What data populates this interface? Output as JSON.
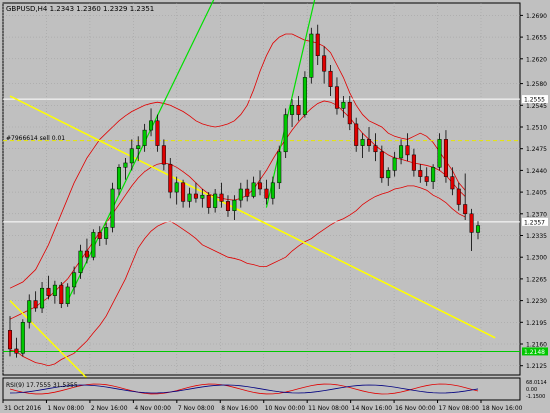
{
  "symbol_label": "GBPUSD,H4  1.2343 1.2360 1.2329 1.2351",
  "order_label": "#7966614 sell 0.01",
  "sub_label": "RSI(9) 17.7555 31.5355",
  "colors": {
    "background": "#c0c0c0",
    "grid": "#9e9e9e",
    "text": "#000000",
    "bull": "#00c800",
    "bear": "#e00000",
    "band": "#e00000",
    "trendline_green": "#00e000",
    "trendline_yellow": "#ffff00",
    "hline_white": "#ffffff",
    "hline_green": "#00c800",
    "order_line": "#e6e600"
  },
  "chart_data": {
    "type": "candlestick",
    "title": "GBPUSD,H4  1.2343 1.2360 1.2329 1.2351",
    "ylim": [
      1.211,
      1.271
    ],
    "y_ticks": [
      "1.2690",
      "1.2655",
      "1.2620",
      "1.2580",
      "1.2545",
      "1.2510",
      "1.2475",
      "1.2440",
      "1.2405",
      "1.2370",
      "1.2335",
      "1.2300",
      "1.2265",
      "1.2230",
      "1.2195",
      "1.2160",
      "1.2125"
    ],
    "x_ticks": [
      "31 Oct 2016",
      "1 Nov 08:00",
      "2 Nov 16:00",
      "4 Nov 00:00",
      "7 Nov 08:00",
      "8 Nov 16:00",
      "10 Nov 00:00",
      "11 Nov 08:00",
      "14 Nov 16:00",
      "16 Nov 00:00",
      "17 Nov 08:00",
      "18 Nov 16:00"
    ],
    "price_tags": [
      {
        "value": "1.2555",
        "level": 1.2555,
        "color": "#ffffff"
      },
      {
        "value": "1.2357",
        "level": 1.2357,
        "color": "#ffffff"
      },
      {
        "value": "1.2148",
        "level": 1.2148,
        "color": "#00c800"
      }
    ],
    "order_level": 1.2488,
    "sub_ticks": [
      "68.0114",
      "0.00",
      "-1.1500"
    ],
    "candles": [
      [
        1.2182,
        1.2205,
        1.214,
        1.2152
      ],
      [
        1.2152,
        1.217,
        1.2138,
        1.2145
      ],
      [
        1.2145,
        1.22,
        1.214,
        1.2195
      ],
      [
        1.2195,
        1.224,
        1.2185,
        1.223
      ],
      [
        1.223,
        1.2245,
        1.2212,
        1.2218
      ],
      [
        1.2218,
        1.226,
        1.221,
        1.225
      ],
      [
        1.225,
        1.227,
        1.2232,
        1.2238
      ],
      [
        1.2238,
        1.2262,
        1.2225,
        1.2255
      ],
      [
        1.2255,
        1.226,
        1.2218,
        1.2225
      ],
      [
        1.2225,
        1.2258,
        1.222,
        1.2252
      ],
      [
        1.2252,
        1.2285,
        1.224,
        1.2275
      ],
      [
        1.2275,
        1.232,
        1.2265,
        1.231
      ],
      [
        1.231,
        1.233,
        1.229,
        1.23
      ],
      [
        1.23,
        1.2345,
        1.2295,
        1.234
      ],
      [
        1.234,
        1.235,
        1.2318,
        1.233
      ],
      [
        1.233,
        1.2355,
        1.232,
        1.2348
      ],
      [
        1.2348,
        1.242,
        1.234,
        1.241
      ],
      [
        1.241,
        1.245,
        1.24,
        1.2445
      ],
      [
        1.2445,
        1.246,
        1.2425,
        1.2452
      ],
      [
        1.2452,
        1.249,
        1.244,
        1.2475
      ],
      [
        1.2475,
        1.2495,
        1.2455,
        1.248
      ],
      [
        1.248,
        1.2515,
        1.247,
        1.2505
      ],
      [
        1.2505,
        1.254,
        1.2495,
        1.252
      ],
      [
        1.252,
        1.253,
        1.247,
        1.248
      ],
      [
        1.248,
        1.249,
        1.244,
        1.245
      ],
      [
        1.245,
        1.246,
        1.2395,
        1.2405
      ],
      [
        1.2405,
        1.243,
        1.2385,
        1.242
      ],
      [
        1.242,
        1.2425,
        1.238,
        1.239
      ],
      [
        1.239,
        1.2412,
        1.238,
        1.2402
      ],
      [
        1.2402,
        1.242,
        1.2388,
        1.2395
      ],
      [
        1.2395,
        1.241,
        1.238,
        1.24
      ],
      [
        1.24,
        1.2405,
        1.237,
        1.238
      ],
      [
        1.238,
        1.241,
        1.2372,
        1.2402
      ],
      [
        1.2402,
        1.242,
        1.238,
        1.239
      ],
      [
        1.239,
        1.24,
        1.2365,
        1.2375
      ],
      [
        1.2375,
        1.24,
        1.236,
        1.2392
      ],
      [
        1.2392,
        1.242,
        1.238,
        1.241
      ],
      [
        1.241,
        1.2425,
        1.239,
        1.2398
      ],
      [
        1.2398,
        1.243,
        1.2395,
        1.242
      ],
      [
        1.242,
        1.244,
        1.24,
        1.241
      ],
      [
        1.241,
        1.2425,
        1.2385,
        1.2395
      ],
      [
        1.2395,
        1.243,
        1.2385,
        1.242
      ],
      [
        1.242,
        1.248,
        1.241,
        1.247
      ],
      [
        1.247,
        1.254,
        1.246,
        1.253
      ],
      [
        1.253,
        1.2555,
        1.251,
        1.2545
      ],
      [
        1.2545,
        1.256,
        1.252,
        1.253
      ],
      [
        1.253,
        1.26,
        1.2525,
        1.259
      ],
      [
        1.259,
        1.267,
        1.258,
        1.266
      ],
      [
        1.266,
        1.2675,
        1.261,
        1.2625
      ],
      [
        1.2625,
        1.264,
        1.258,
        1.26
      ],
      [
        1.26,
        1.261,
        1.256,
        1.2575
      ],
      [
        1.2575,
        1.259,
        1.253,
        1.254
      ],
      [
        1.254,
        1.256,
        1.2525,
        1.255
      ],
      [
        1.255,
        1.256,
        1.2505,
        1.2515
      ],
      [
        1.2515,
        1.2525,
        1.247,
        1.248
      ],
      [
        1.248,
        1.25,
        1.246,
        1.249
      ],
      [
        1.249,
        1.251,
        1.247,
        1.248
      ],
      [
        1.248,
        1.25,
        1.2455,
        1.247
      ],
      [
        1.247,
        1.248,
        1.242,
        1.2428
      ],
      [
        1.2428,
        1.2445,
        1.2415,
        1.244
      ],
      [
        1.244,
        1.247,
        1.243,
        1.246
      ],
      [
        1.246,
        1.249,
        1.245,
        1.248
      ],
      [
        1.248,
        1.25,
        1.2455,
        1.2465
      ],
      [
        1.2465,
        1.2475,
        1.243,
        1.244
      ],
      [
        1.244,
        1.245,
        1.242,
        1.243
      ],
      [
        1.243,
        1.2445,
        1.2415,
        1.2422
      ],
      [
        1.2422,
        1.245,
        1.241,
        1.2445
      ],
      [
        1.2445,
        1.25,
        1.244,
        1.249
      ],
      [
        1.249,
        1.2505,
        1.242,
        1.243
      ],
      [
        1.243,
        1.2445,
        1.24,
        1.241
      ],
      [
        1.241,
        1.242,
        1.2375,
        1.2385
      ],
      [
        1.2385,
        1.2435,
        1.236,
        1.237
      ],
      [
        1.237,
        1.2378,
        1.231,
        1.234
      ],
      [
        1.234,
        1.2358,
        1.2329,
        1.2351
      ]
    ],
    "bands": {
      "upper": [
        1.225,
        1.2255,
        1.226,
        1.227,
        1.228,
        1.23,
        1.232,
        1.2345,
        1.237,
        1.2395,
        1.242,
        1.244,
        1.246,
        1.2475,
        1.249,
        1.25,
        1.251,
        1.252,
        1.2528,
        1.2535,
        1.254,
        1.2545,
        1.2548,
        1.255,
        1.2548,
        1.2545,
        1.254,
        1.2535,
        1.2528,
        1.252,
        1.2515,
        1.2512,
        1.251,
        1.2512,
        1.2515,
        1.252,
        1.253,
        1.2545,
        1.257,
        1.26,
        1.2625,
        1.2645,
        1.2655,
        1.266,
        1.266,
        1.2655,
        1.265,
        1.2648,
        1.2645,
        1.264,
        1.263,
        1.261,
        1.259,
        1.2565,
        1.2545,
        1.253,
        1.252,
        1.2515,
        1.251,
        1.25,
        1.2495,
        1.2492,
        1.249,
        1.2495,
        1.25,
        1.2495,
        1.2485,
        1.247,
        1.2455,
        1.244,
        1.242,
        1.2408
      ],
      "middle": [
        1.22,
        1.2205,
        1.221,
        1.2215,
        1.222,
        1.2228,
        1.2235,
        1.2245,
        1.2255,
        1.2265,
        1.228,
        1.2295,
        1.231,
        1.2325,
        1.234,
        1.2355,
        1.237,
        1.2385,
        1.24,
        1.2415,
        1.2428,
        1.2438,
        1.2445,
        1.245,
        1.2452,
        1.245,
        1.2445,
        1.2438,
        1.243,
        1.242,
        1.241,
        1.2402,
        1.2398,
        1.2395,
        1.2393,
        1.2392,
        1.2395,
        1.24,
        1.241,
        1.2425,
        1.244,
        1.2458,
        1.2475,
        1.249,
        1.2505,
        1.2518,
        1.253,
        1.254,
        1.2548,
        1.2552,
        1.255,
        1.2545,
        1.2535,
        1.2525,
        1.2512,
        1.25,
        1.249,
        1.248,
        1.2472,
        1.2465,
        1.246,
        1.2458,
        1.2455,
        1.2452,
        1.245,
        1.2448,
        1.2445,
        1.244,
        1.2432,
        1.242,
        1.2408,
        1.2398
      ],
      "lower": [
        1.215,
        1.2148,
        1.214,
        1.2135,
        1.213,
        1.2128,
        1.2125,
        1.2128,
        1.2135,
        1.214,
        1.2145,
        1.2155,
        1.2165,
        1.2178,
        1.219,
        1.2205,
        1.2225,
        1.2245,
        1.2265,
        1.229,
        1.2315,
        1.233,
        1.2342,
        1.235,
        1.2355,
        1.2358,
        1.2352,
        1.2345,
        1.2338,
        1.233,
        1.232,
        1.2315,
        1.231,
        1.2305,
        1.23,
        1.2298,
        1.2295,
        1.229,
        1.2288,
        1.2285,
        1.2285,
        1.229,
        1.2295,
        1.23,
        1.231,
        1.2318,
        1.2325,
        1.233,
        1.2338,
        1.2345,
        1.2352,
        1.2358,
        1.2362,
        1.2368,
        1.2375,
        1.2385,
        1.2392,
        1.2398,
        1.2402,
        1.2405,
        1.241,
        1.2412,
        1.2415,
        1.2415,
        1.2412,
        1.2408,
        1.24,
        1.2395,
        1.2388,
        1.2378,
        1.237,
        1.2365
      ]
    }
  }
}
